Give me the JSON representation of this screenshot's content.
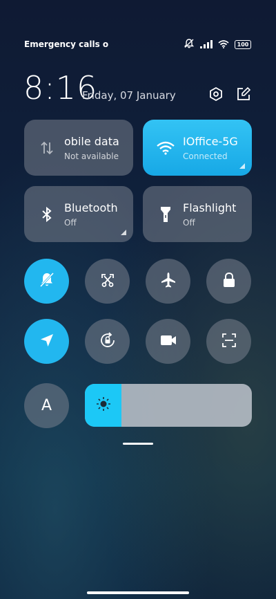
{
  "status_bar": {
    "left_text": "Emergency calls o",
    "battery": "100",
    "icons": [
      "dnd-bell-off-icon",
      "signal-icon",
      "wifi-icon",
      "battery-icon"
    ]
  },
  "header": {
    "time": "8:16",
    "date": "Friday, 07 January",
    "icons": [
      "settings-hexagon-icon",
      "edit-icon"
    ]
  },
  "tiles": {
    "mobile_data": {
      "title": "obile data",
      "subtitle": "Not available",
      "icon": "data-arrows-icon"
    },
    "wifi": {
      "title": "IOffice-5G",
      "subtitle": "Connected",
      "icon": "wifi-icon"
    },
    "bluetooth": {
      "title": "Bluetooth",
      "subtitle": "Off",
      "icon": "bluetooth-icon"
    },
    "flashlight": {
      "title": "Flashlight",
      "subtitle": "Off",
      "icon": "flashlight-icon"
    }
  },
  "toggles": [
    {
      "name": "silent-toggle",
      "icon": "bell-off-icon",
      "active": true
    },
    {
      "name": "screenshot-toggle",
      "icon": "scissors-icon",
      "active": false
    },
    {
      "name": "airplane-toggle",
      "icon": "airplane-icon",
      "active": false
    },
    {
      "name": "lock-toggle",
      "icon": "lock-icon",
      "active": false
    },
    {
      "name": "location-toggle",
      "icon": "location-arrow-icon",
      "active": true
    },
    {
      "name": "rotation-lock-toggle",
      "icon": "rotation-lock-icon",
      "active": false
    },
    {
      "name": "screen-record-toggle",
      "icon": "video-camera-icon",
      "active": false
    },
    {
      "name": "scan-toggle",
      "icon": "scan-icon",
      "active": false
    }
  ],
  "auto_brightness": {
    "label": "A"
  },
  "brightness": {
    "level": 0.22,
    "icon": "sun-icon"
  },
  "colors": {
    "accent": "#22b7ef",
    "tile_gray": "#6f7884"
  }
}
